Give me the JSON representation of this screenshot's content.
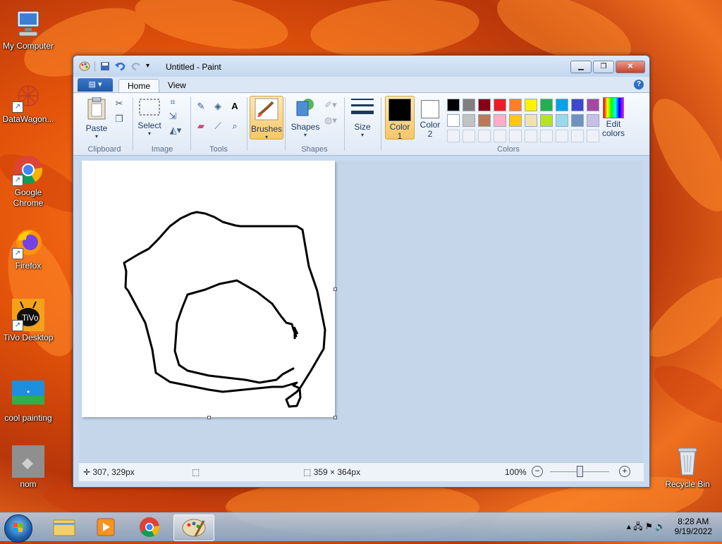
{
  "desktop": {
    "icons": [
      {
        "label": "My Computer"
      },
      {
        "label": "DataWagon..."
      },
      {
        "label": "Google Chrome"
      },
      {
        "label": "Firefox"
      },
      {
        "label": "TiVo Desktop"
      },
      {
        "label": "cool painting"
      },
      {
        "label": "nom"
      },
      {
        "label": "Recycle Bin"
      }
    ]
  },
  "window": {
    "title": "Untitled - Paint",
    "tabs": [
      "Home",
      "View"
    ],
    "ribbon": {
      "paste": "Paste",
      "select": "Select",
      "brushes": "Brushes",
      "shapes": "Shapes",
      "size": "Size",
      "color1": "Color 1",
      "color2": "Color 2",
      "edit_colors": "Edit colors",
      "groups": {
        "clipboard": "Clipboard",
        "image": "Image",
        "tools": "Tools",
        "shapes": "Shapes",
        "colors": "Colors"
      }
    },
    "palette": {
      "row1": [
        "#000000",
        "#7f7f7f",
        "#880015",
        "#ed1c24",
        "#ff7f27",
        "#fff200",
        "#22b14c",
        "#00a2e8",
        "#3f48cc",
        "#a349a4"
      ],
      "row2": [
        "#ffffff",
        "#c3c3c3",
        "#b97a57",
        "#ffaec9",
        "#ffc90e",
        "#efe4b0",
        "#b5e61d",
        "#99d9ea",
        "#7092be",
        "#c8bfe7"
      ]
    },
    "status": {
      "cursor_pos": "307, 329px",
      "canvas_size": "359 × 364px",
      "zoom": "100%"
    }
  },
  "taskbar": {
    "time": "8:28 AM",
    "date": "9/19/2022"
  }
}
